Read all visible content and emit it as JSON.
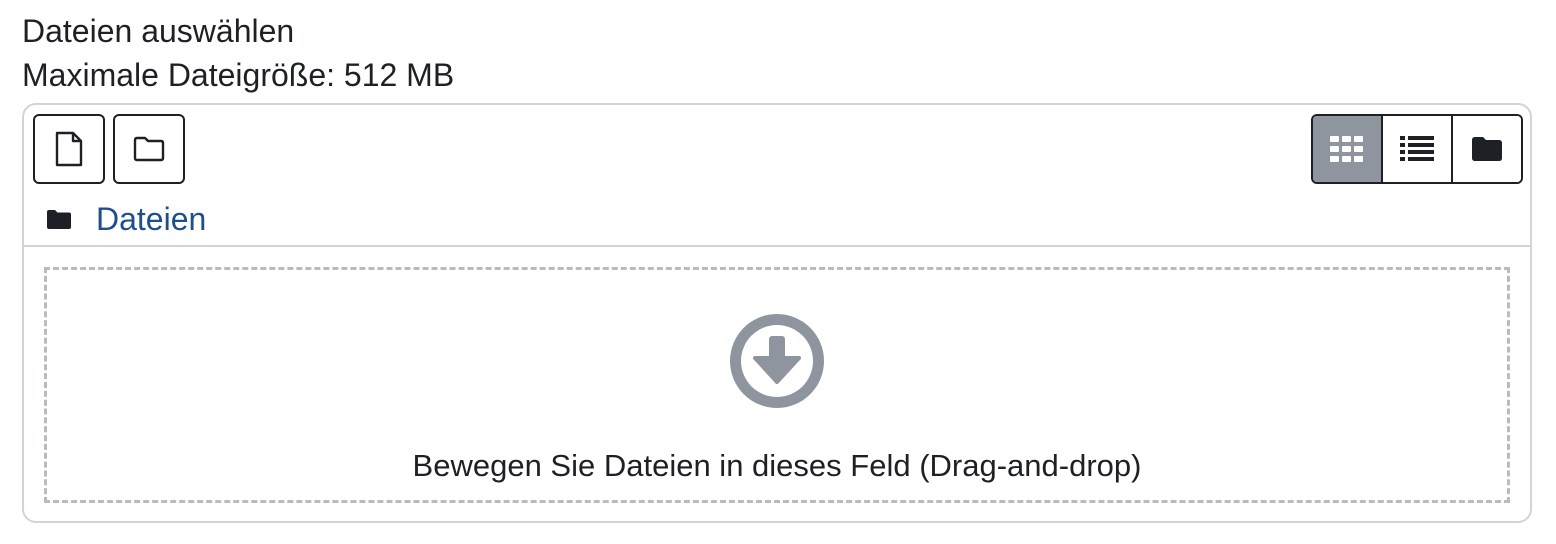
{
  "field": {
    "title": "Dateien auswählen",
    "max_size_label": "Maximale Dateigröße: 512 MB"
  },
  "toolbar": {
    "add_file_icon": "file-icon",
    "add_folder_icon": "folder-outline-icon",
    "views": [
      {
        "icon": "grid-icon",
        "active": true
      },
      {
        "icon": "list-icon",
        "active": false
      },
      {
        "icon": "folder-tree-icon",
        "active": false
      }
    ]
  },
  "breadcrumb": {
    "icon": "folder-icon",
    "label": "Dateien"
  },
  "dropzone": {
    "icon": "download-arrow-icon",
    "text": "Bewegen Sie Dateien in dieses Feld (Drag-and-drop)"
  },
  "colors": {
    "link": "#1f4e8c",
    "active_view": "#8f959e",
    "border": "#d2d4d7",
    "icon_gray": "#8f959e"
  }
}
